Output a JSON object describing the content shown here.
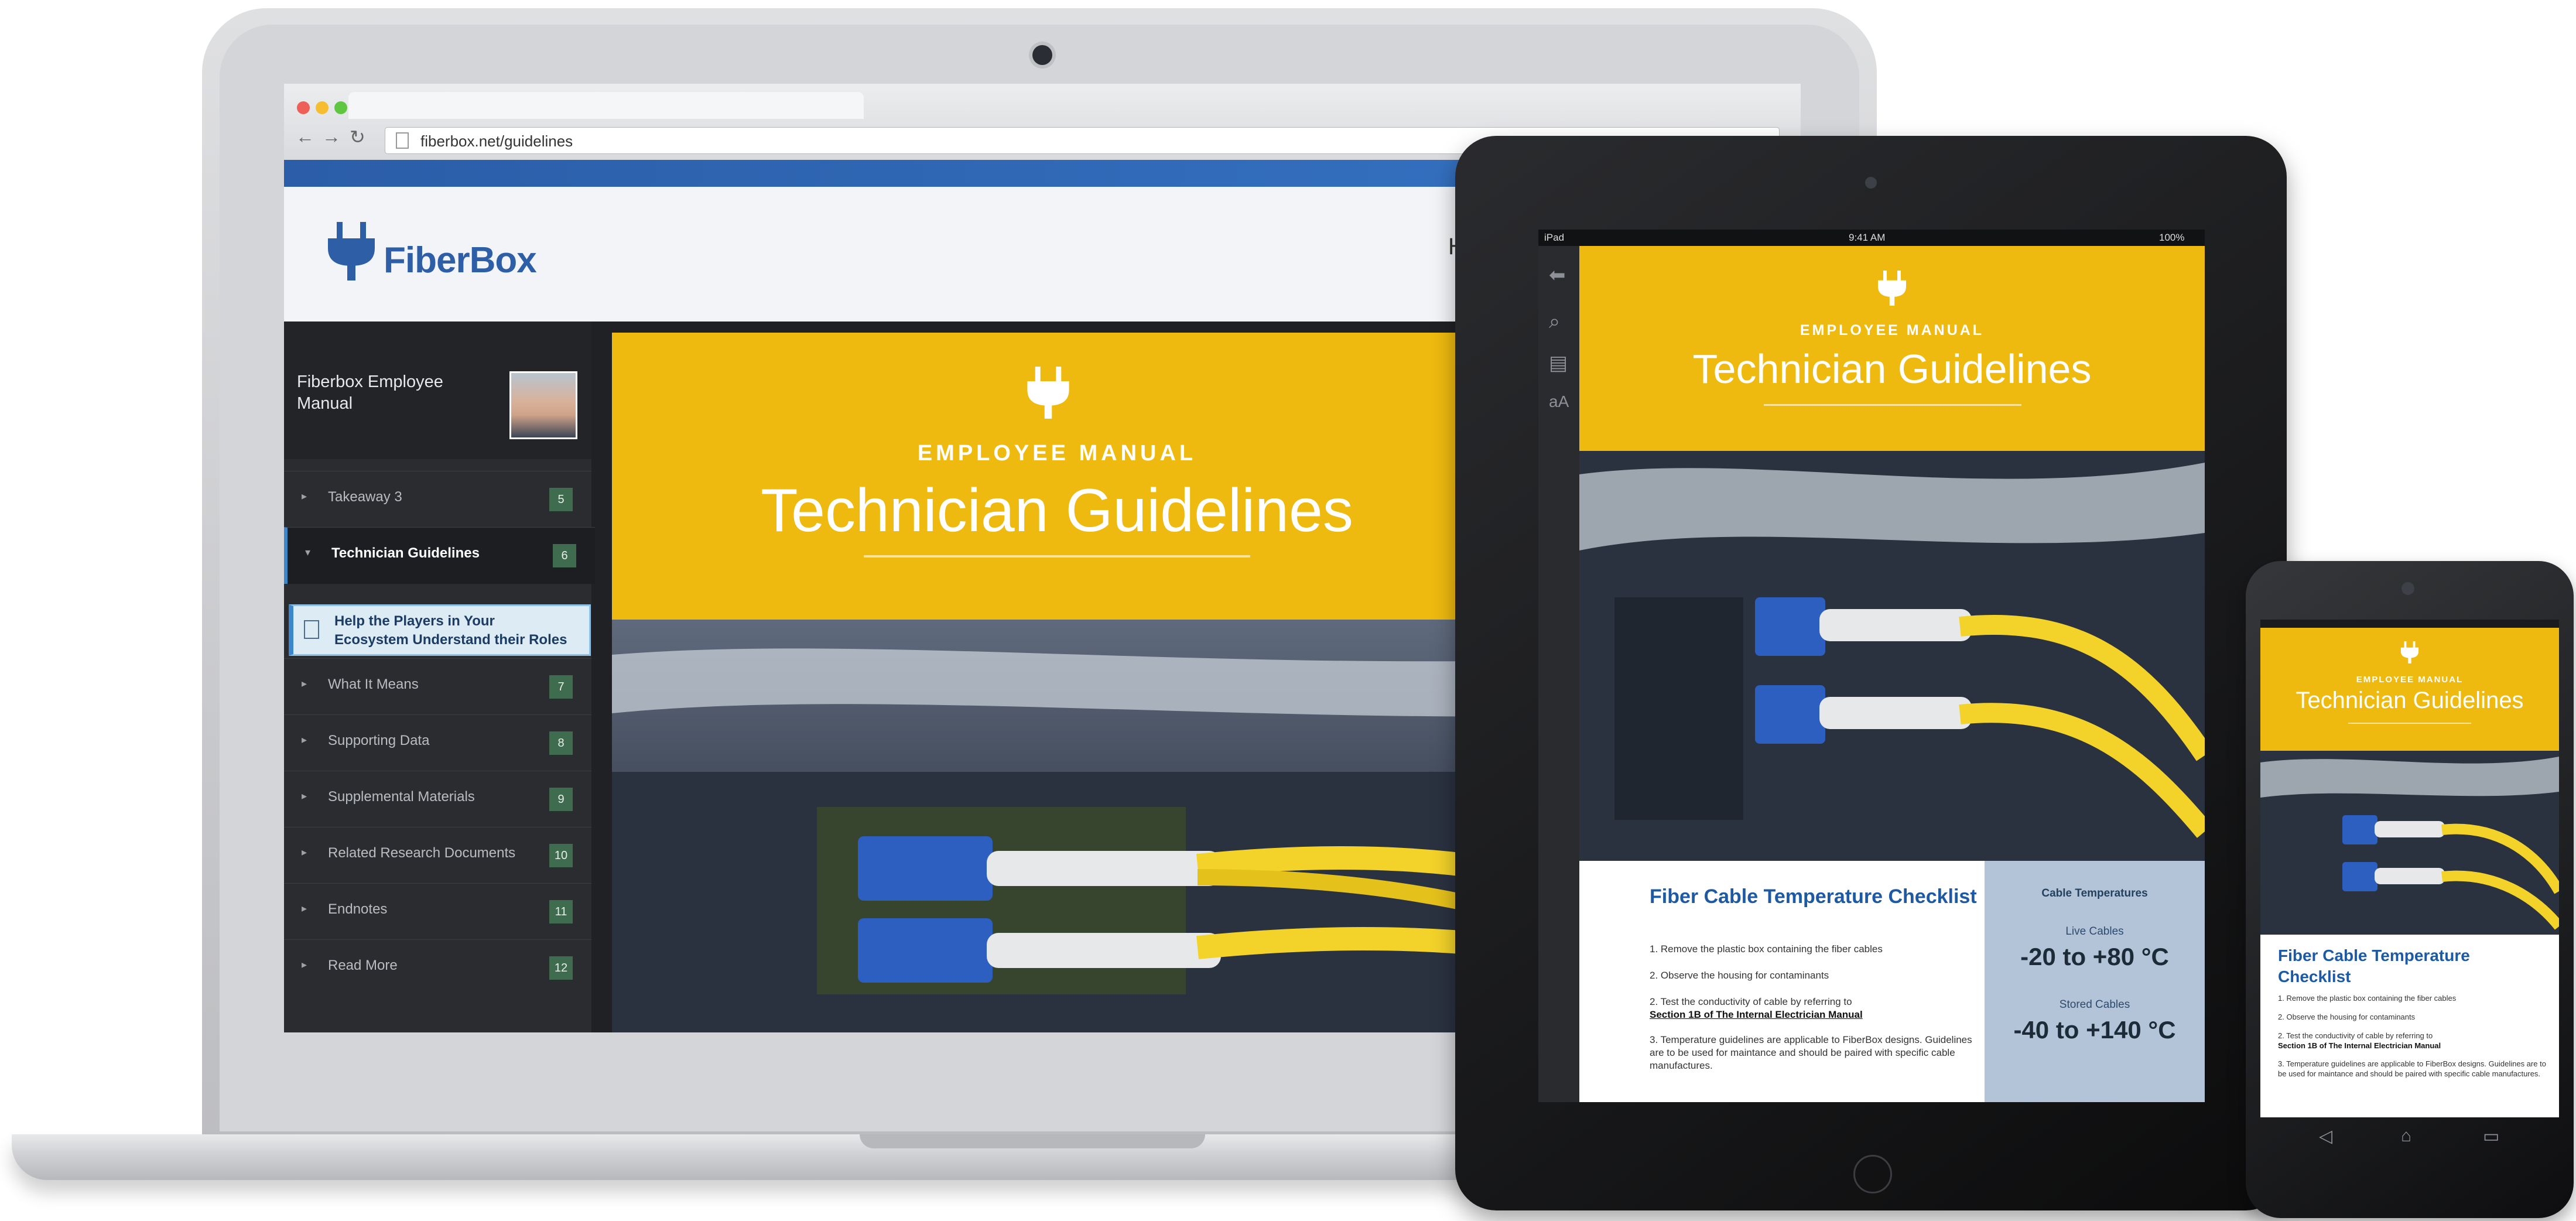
{
  "browser": {
    "url": "fiberbox.net/guidelines",
    "back_glyph": "←",
    "forward_glyph": "→",
    "reload_glyph": "↻"
  },
  "site": {
    "logo_text": "FiberBox",
    "header_nav_partial": "H"
  },
  "sidebar": {
    "title": "Fiberbox Employee Manual",
    "items": [
      {
        "label": "Takeaway 3",
        "number": "5"
      },
      {
        "label": "Technician Guidelines",
        "number": "6"
      },
      {
        "label": "What It Means",
        "number": "7"
      },
      {
        "label": "Supporting Data",
        "number": "8"
      },
      {
        "label": "Supplemental Materials",
        "number": "9"
      },
      {
        "label": "Related Research Documents",
        "number": "10"
      },
      {
        "label": "Endnotes",
        "number": "11"
      },
      {
        "label": "Read More",
        "number": "12"
      }
    ],
    "active_subitem": "Help the Players in Your Ecosystem Understand their Roles"
  },
  "hero": {
    "kicker": "EMPLOYEE MANUAL",
    "title": "Technician Guidelines"
  },
  "tablet": {
    "status_left": "iPad",
    "status_time": "9:41 AM",
    "status_right": "100%",
    "checklist_title": "Fiber Cable Temperature Checklist",
    "steps": [
      "1. Remove the plastic box containing the fiber cables",
      "2. Observe the housing for contaminants",
      "2. Test the conductivity of cable by referring to",
      "Section 1B of The Internal Electrician Manual",
      "3. Temperature guidelines are applicable to FiberBox designs. Guidelines are to be used for maintance and should be paired with specific cable manufactures."
    ],
    "temps_title": "Cable Temperatures",
    "live_label": "Live Cables",
    "live_value": "-20 to +80 °C",
    "stored_label": "Stored Cables",
    "stored_value": "-40 to +140 °C"
  },
  "phone": {
    "checklist_title": "Fiber Cable Temperature Checklist",
    "steps": [
      "1. Remove the plastic box containing the fiber cables",
      "2. Observe the housing for contaminants",
      "2. Test the conductivity of cable by referring to",
      "Section 1B of The Internal Electrician Manual",
      "3. Temperature guidelines are applicable to FiberBox designs. Guidelines are to be used for maintance and should be paired with specific cable manufactures."
    ],
    "nav_back": "◁",
    "nav_home": "⌂",
    "nav_recent": "▭"
  },
  "icons": {
    "plug": "plug-icon",
    "search": "search-icon",
    "back": "back-arrow-icon",
    "notes": "notes-icon",
    "text_size": "text-size-icon"
  },
  "colors": {
    "brand_blue": "#2e5fa6",
    "hero_yellow": "#eeba0f",
    "sidebar_dark": "#2a2c30",
    "badge_green": "#3f6b4f"
  }
}
